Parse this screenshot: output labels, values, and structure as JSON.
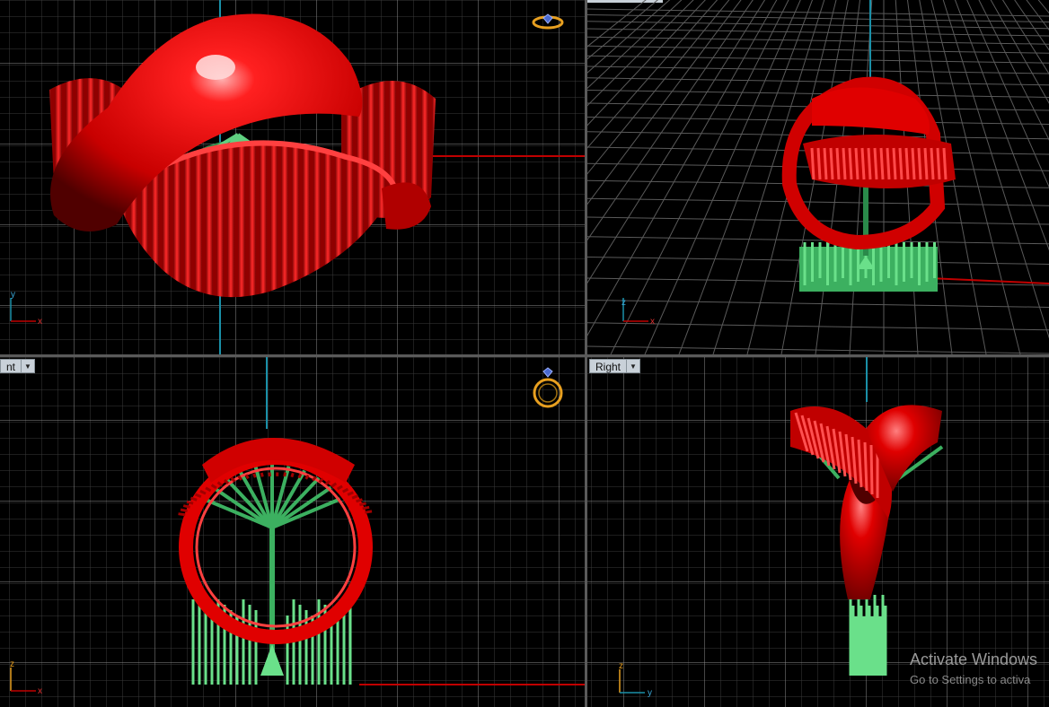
{
  "viewports": {
    "top_left": {
      "label": "",
      "axes": [
        "y",
        "x"
      ]
    },
    "top_right": {
      "label": "",
      "axes": [
        "z",
        "x"
      ]
    },
    "bottom_left": {
      "label": "nt",
      "axes": [
        "z",
        "x"
      ]
    },
    "bottom_right": {
      "label": "Right",
      "axes": [
        "z",
        "y"
      ]
    }
  },
  "watermark": {
    "title": "Activate Windows",
    "subtitle": "Go to Settings to activa"
  },
  "colors": {
    "background": "#000000",
    "grid_minor": "#3a3a3a",
    "grid_major": "#8a8a8a",
    "axis_x": "#c00000",
    "axis_y": "#1a90a8",
    "model_red": "#e00000",
    "support_green": "#3cb060"
  },
  "icons": [
    "ring-gem-icon",
    "dropdown-arrow-icon"
  ]
}
